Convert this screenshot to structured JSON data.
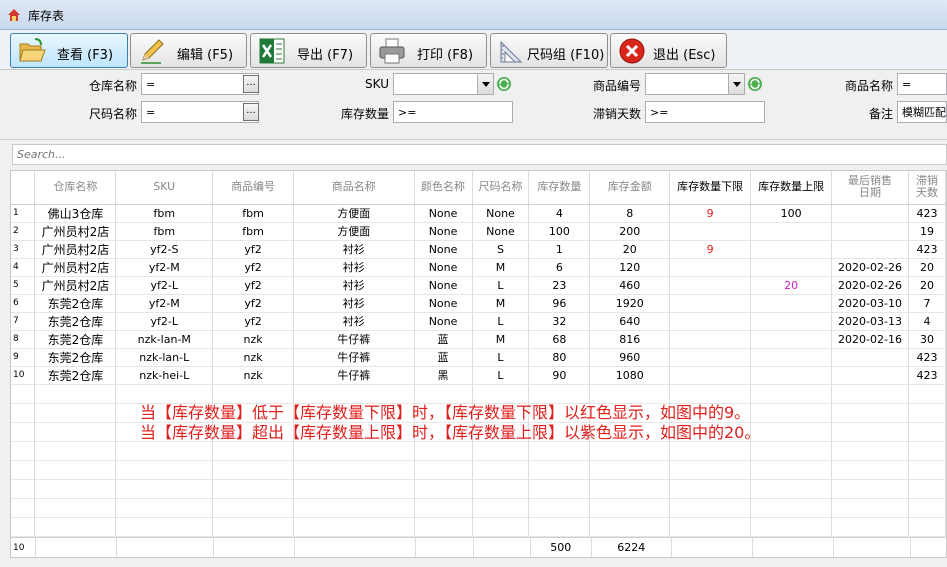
{
  "window": {
    "title": "库存表"
  },
  "toolbar": {
    "view_label": "查看 (F3)",
    "edit_label": "编辑 (F5)",
    "export_label": "导出 (F7)",
    "print_label": "打印 (F8)",
    "sizegroup_label": "尺码组 (F10)",
    "exit_label": "退出 (Esc)"
  },
  "filters": {
    "warehouse_label": "仓库名称",
    "warehouse_value": "=",
    "sku_label": "SKU",
    "sku_value": "",
    "product_code_label": "商品编号",
    "product_code_value": "",
    "product_name_label": "商品名称",
    "product_name_value": "=",
    "size_label": "尺码名称",
    "size_value": "=",
    "qty_label": "库存数量",
    "qty_value": ">=",
    "stale_label": "滞销天数",
    "stale_value": ">=",
    "remark_label": "备注",
    "remark_value": "模糊匹配"
  },
  "search": {
    "placeholder": "Search..."
  },
  "grid": {
    "columns": [
      "仓库名称",
      "SKU",
      "商品编号",
      "商品名称",
      "颜色名称",
      "尺码名称",
      "库存数量",
      "库存金额",
      "库存数量下限",
      "库存数量上限",
      "最后销售日期",
      "滞销天数"
    ],
    "rows": [
      {
        "n": "1",
        "wh": "佛山3仓库",
        "sku": "fbm",
        "code": "fbm",
        "name": "方便面",
        "color": "None",
        "size": "None",
        "qty": "4",
        "amt": "8",
        "min": "9",
        "max": "100",
        "last": "",
        "days": "423"
      },
      {
        "n": "2",
        "wh": "广州员村2店",
        "sku": "fbm",
        "code": "fbm",
        "name": "方便面",
        "color": "None",
        "size": "None",
        "qty": "100",
        "amt": "200",
        "min": "",
        "max": "",
        "last": "",
        "days": "19"
      },
      {
        "n": "3",
        "wh": "广州员村2店",
        "sku": "yf2-S",
        "code": "yf2",
        "name": "衬衫",
        "color": "None",
        "size": "S",
        "qty": "1",
        "amt": "20",
        "min": "9",
        "max": "",
        "last": "",
        "days": "423"
      },
      {
        "n": "4",
        "wh": "广州员村2店",
        "sku": "yf2-M",
        "code": "yf2",
        "name": "衬衫",
        "color": "None",
        "size": "M",
        "qty": "6",
        "amt": "120",
        "min": "",
        "max": "",
        "last": "2020-02-26",
        "days": "20"
      },
      {
        "n": "5",
        "wh": "广州员村2店",
        "sku": "yf2-L",
        "code": "yf2",
        "name": "衬衫",
        "color": "None",
        "size": "L",
        "qty": "23",
        "amt": "460",
        "min": "",
        "max": "20",
        "last": "2020-02-26",
        "days": "20"
      },
      {
        "n": "6",
        "wh": "东莞2仓库",
        "sku": "yf2-M",
        "code": "yf2",
        "name": "衬衫",
        "color": "None",
        "size": "M",
        "qty": "96",
        "amt": "1920",
        "min": "",
        "max": "",
        "last": "2020-03-10",
        "days": "7"
      },
      {
        "n": "7",
        "wh": "东莞2仓库",
        "sku": "yf2-L",
        "code": "yf2",
        "name": "衬衫",
        "color": "None",
        "size": "L",
        "qty": "32",
        "amt": "640",
        "min": "",
        "max": "",
        "last": "2020-03-13",
        "days": "4"
      },
      {
        "n": "8",
        "wh": "东莞2仓库",
        "sku": "nzk-lan-M",
        "code": "nzk",
        "name": "牛仔裤",
        "color": "蓝",
        "size": "M",
        "qty": "68",
        "amt": "816",
        "min": "",
        "max": "",
        "last": "2020-02-16",
        "days": "30"
      },
      {
        "n": "9",
        "wh": "东莞2仓库",
        "sku": "nzk-lan-L",
        "code": "nzk",
        "name": "牛仔裤",
        "color": "蓝",
        "size": "L",
        "qty": "80",
        "amt": "960",
        "min": "",
        "max": "",
        "last": "",
        "days": "423"
      },
      {
        "n": "10",
        "wh": "东莞2仓库",
        "sku": "nzk-hei-L",
        "code": "nzk",
        "name": "牛仔裤",
        "color": "黑",
        "size": "L",
        "qty": "90",
        "amt": "1080",
        "min": "",
        "max": "",
        "last": "",
        "days": "423"
      }
    ],
    "footer": {
      "count": "10",
      "qty_total": "500",
      "amt_total": "6224"
    }
  },
  "note": {
    "line1": "当【库存数量】低于【库存数量下限】时，【库存数量下限】以红色显示，如图中的9。",
    "line2": "当【库存数量】超出【库存数量上限】时，【库存数量上限】以紫色显示，如图中的20。"
  },
  "colors": {
    "below_min": "#e0201c",
    "above_max": "#c81ec8"
  }
}
